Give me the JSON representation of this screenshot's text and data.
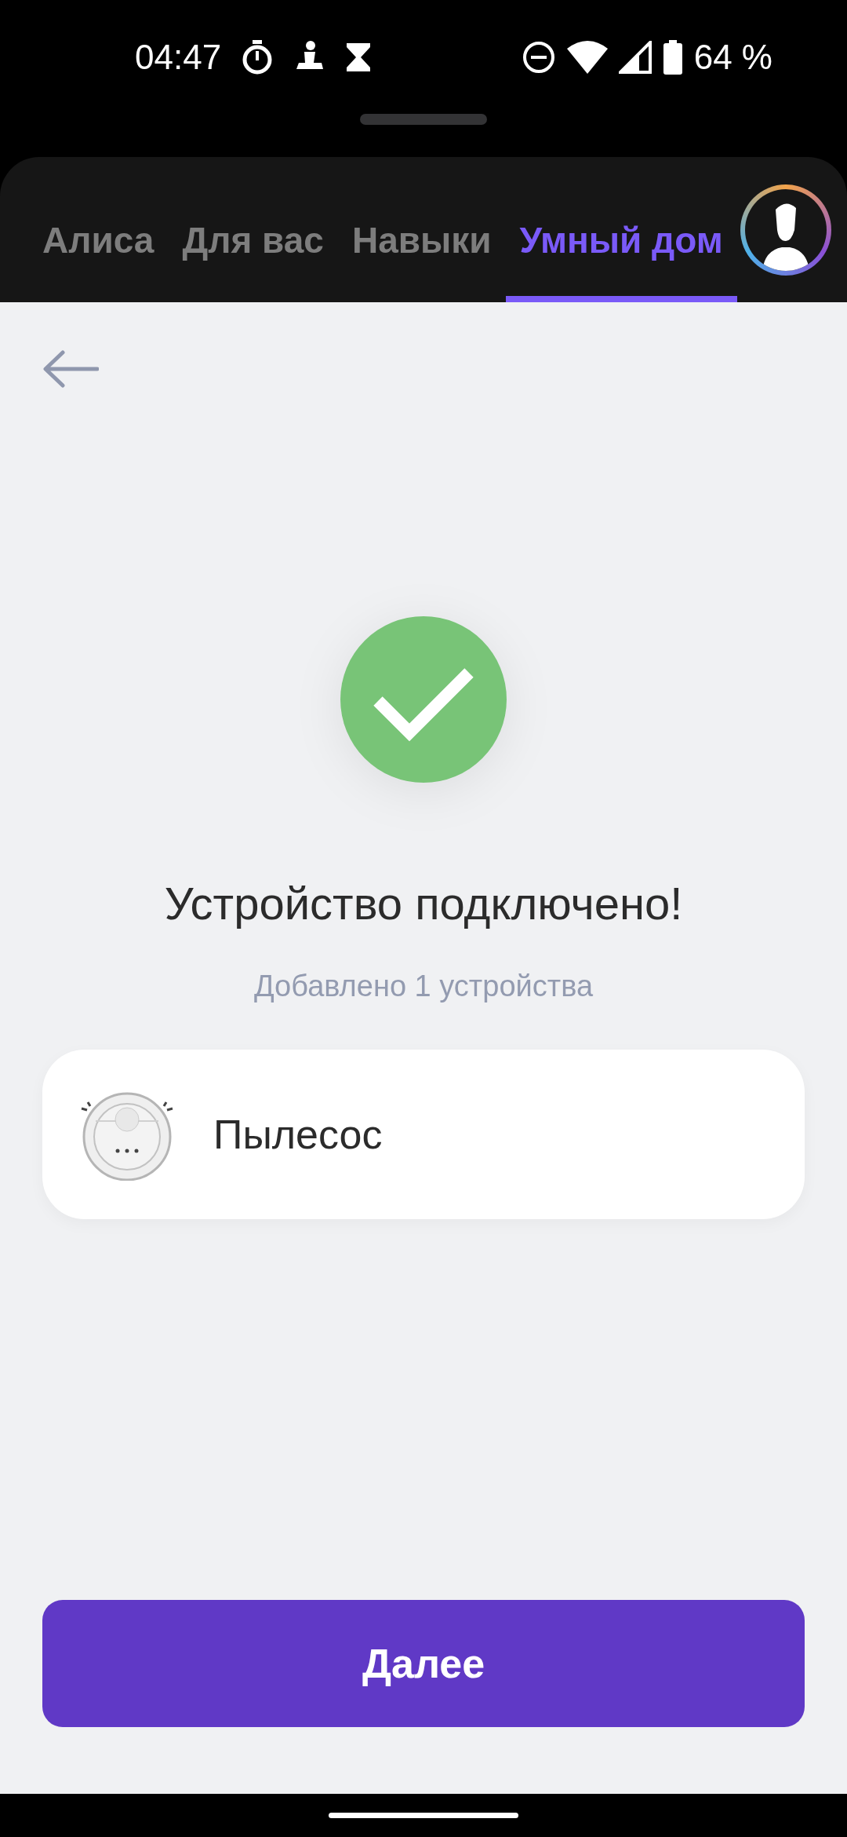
{
  "status_bar": {
    "time": "04:47",
    "battery": "64 %"
  },
  "tabs": [
    {
      "label": "Алиса",
      "selected": false
    },
    {
      "label": "Для вас",
      "selected": false
    },
    {
      "label": "Навыки",
      "selected": false
    },
    {
      "label": "Умный дом",
      "selected": true
    }
  ],
  "title": "Устройство подключено!",
  "subtitle": "Добавлено 1 устройства",
  "devices": [
    {
      "name": "Пылесос"
    }
  ],
  "next_button": "Далее"
}
